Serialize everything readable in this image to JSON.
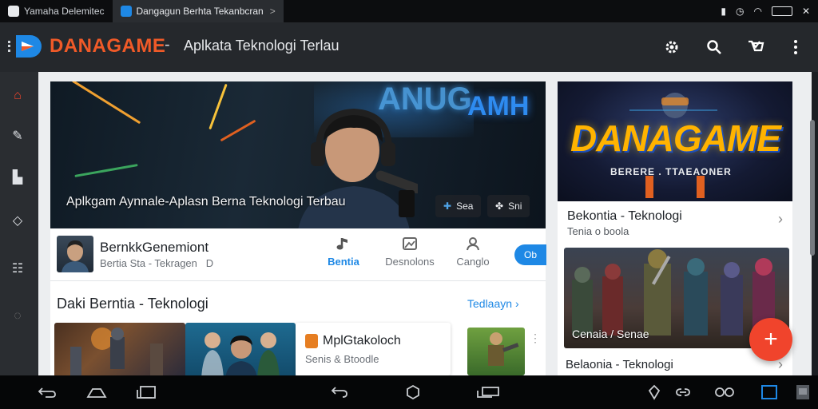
{
  "tabs": [
    {
      "label": "Yamaha Delemitec",
      "active": false
    },
    {
      "label": "Dangagun Berhta Tekanbcran",
      "active": true
    }
  ],
  "tab_chevron": ">",
  "header": {
    "brand": "DANAGAME",
    "separator": "-",
    "subtitle": "Aplkata Teknologi Terlau",
    "brand_color": "#f05a28"
  },
  "hero": {
    "neon_text_1": "ANUG",
    "neon_text_2": "AMH",
    "title": "Aplkgam Aynnale-Aplasn Berna Teknologi Terbau",
    "button_1": "Sea",
    "button_2": "Sni"
  },
  "channel": {
    "name": "BernkkGenemiont",
    "subtitle": "Bertia Sta - Tekragen",
    "subtitle_suffix": "D",
    "tabs": [
      {
        "label": "Bentia",
        "icon": "music-note-icon",
        "active": true
      },
      {
        "label": "Desnolons",
        "icon": "image-icon",
        "active": false
      },
      {
        "label": "Canglo",
        "icon": "person-icon",
        "active": false
      }
    ],
    "pill_label": "Ob"
  },
  "section": {
    "title": "Daki Berntia - Teknologi",
    "link": "Tedlaayn"
  },
  "card": {
    "title": "MplGtakoloch",
    "subtitle": "Senis & Btoodle"
  },
  "side": {
    "promo_title": "DANAGAME",
    "promo_subtitle": "BERERE . TTAEAONER",
    "row_title": "Bekontia - Teknologi",
    "row_subtitle": "Tenia o boola",
    "battle_caption": "Cenaia / Senae",
    "bottom_title": "Belaonia - Teknologi"
  },
  "accent_color": "#1e88e5",
  "fab_color": "#f0442c"
}
